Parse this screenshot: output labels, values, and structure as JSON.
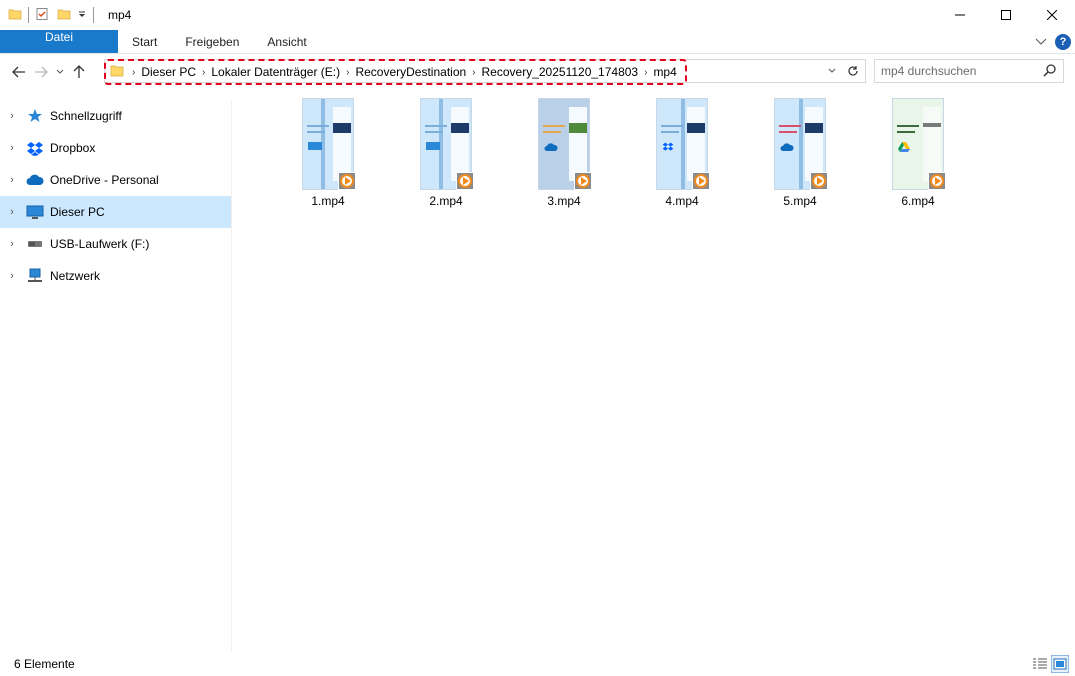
{
  "window": {
    "title": "mp4"
  },
  "ribbon": {
    "tabs": [
      "Datei",
      "Start",
      "Freigeben",
      "Ansicht"
    ],
    "file_tab_color": "#1979ca"
  },
  "address": {
    "crumbs": [
      "Dieser PC",
      "Lokaler Datenträger (E:)",
      "RecoveryDestination",
      "Recovery_20251120_174803",
      "mp4"
    ],
    "highlight_color": "#e0001b"
  },
  "search": {
    "placeholder": "mp4 durchsuchen"
  },
  "sidebar": {
    "items": [
      {
        "label": "Schnellzugriff",
        "icon": "star-icon"
      },
      {
        "label": "Dropbox",
        "icon": "dropbox-icon"
      },
      {
        "label": "OneDrive - Personal",
        "icon": "cloud-icon"
      },
      {
        "label": "Dieser PC",
        "icon": "computer-icon",
        "selected": true
      },
      {
        "label": "USB-Laufwerk (F:)",
        "icon": "usb-drive-icon"
      },
      {
        "label": "Netzwerk",
        "icon": "network-icon"
      }
    ]
  },
  "files": [
    {
      "name": "1.mp4",
      "logo": "monitor-icon",
      "bg": "#cfe7fb"
    },
    {
      "name": "2.mp4",
      "logo": "monitor-icon",
      "bg": "#cfe7fb"
    },
    {
      "name": "3.mp4",
      "logo": "cloud-icon",
      "bg": "#b9d0e8"
    },
    {
      "name": "4.mp4",
      "logo": "dropbox-icon",
      "bg": "#cfe7fb"
    },
    {
      "name": "5.mp4",
      "logo": "cloud-icon",
      "bg": "#cfe7fb"
    },
    {
      "name": "6.mp4",
      "logo": "google-drive-icon",
      "bg": "#e8f5e8"
    }
  ],
  "status": {
    "count": "6 Elemente"
  }
}
